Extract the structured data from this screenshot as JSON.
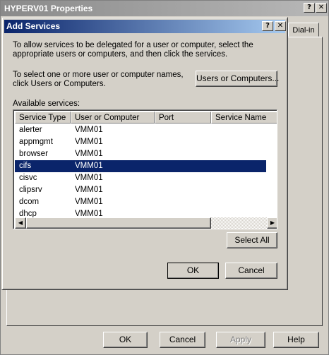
{
  "outer_window": {
    "title": "HYPERV01 Properties",
    "help_glyph": "?",
    "close_glyph": "✕",
    "tab_label": "Dial-in",
    "buttons": {
      "ok": "OK",
      "cancel": "Cancel",
      "apply": "Apply",
      "help": "Help"
    }
  },
  "dialog": {
    "title": "Add Services",
    "help_glyph": "?",
    "close_glyph": "✕",
    "intro_text": "To allow services to be delegated for a user or computer, select the appropriate users or computers, and then click the services.",
    "select_text": "To select one or more user or computer names, click Users or Computers.",
    "users_button": "Users or Computers...",
    "available_label": "Available services:",
    "columns": [
      "Service Type",
      "User or Computer",
      "Port",
      "Service Name"
    ],
    "rows": [
      {
        "service_type": "alerter",
        "user_or_computer": "VMM01",
        "selected": false
      },
      {
        "service_type": "appmgmt",
        "user_or_computer": "VMM01",
        "selected": false
      },
      {
        "service_type": "browser",
        "user_or_computer": "VMM01",
        "selected": false
      },
      {
        "service_type": "cifs",
        "user_or_computer": "VMM01",
        "selected": true
      },
      {
        "service_type": "cisvc",
        "user_or_computer": "VMM01",
        "selected": false
      },
      {
        "service_type": "clipsrv",
        "user_or_computer": "VMM01",
        "selected": false
      },
      {
        "service_type": "dcom",
        "user_or_computer": "VMM01",
        "selected": false
      },
      {
        "service_type": "dhcp",
        "user_or_computer": "VMM01",
        "selected": false
      }
    ],
    "select_all_button": "Select All",
    "ok_button": "OK",
    "cancel_button": "Cancel"
  },
  "colors": {
    "selection": "#0a246a",
    "active_title_start": "#0a246a",
    "active_title_end": "#a6caf0",
    "inactive_title": "#8a8a8a",
    "face": "#d4d0c8"
  },
  "icons": {
    "scroll_up": "arrow-up-icon",
    "scroll_down": "arrow-down-icon",
    "scroll_left": "arrow-left-icon",
    "scroll_right": "arrow-right-icon"
  }
}
